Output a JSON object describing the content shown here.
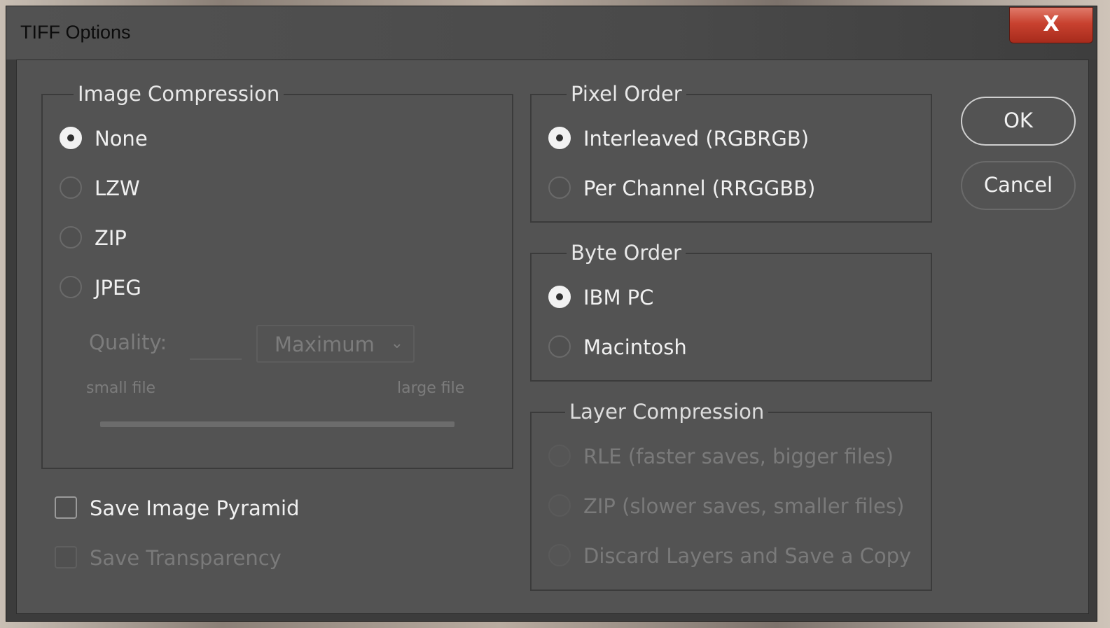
{
  "window": {
    "title": "TIFF Options",
    "close_glyph": "X"
  },
  "image_compression": {
    "legend": "Image Compression",
    "options": [
      {
        "label": "None",
        "selected": true
      },
      {
        "label": "LZW",
        "selected": false
      },
      {
        "label": "ZIP",
        "selected": false
      },
      {
        "label": "JPEG",
        "selected": false
      }
    ],
    "quality_label": "Quality:",
    "quality_value": "",
    "quality_select": "Maximum",
    "small_file_label": "small file",
    "large_file_label": "large file"
  },
  "pixel_order": {
    "legend": "Pixel Order",
    "options": [
      {
        "label": "Interleaved (RGBRGB)",
        "selected": true
      },
      {
        "label": "Per Channel (RRGGBB)",
        "selected": false
      }
    ]
  },
  "byte_order": {
    "legend": "Byte Order",
    "options": [
      {
        "label": "IBM PC",
        "selected": true
      },
      {
        "label": "Macintosh",
        "selected": false
      }
    ]
  },
  "layer_compression": {
    "legend": "Layer Compression",
    "options": [
      {
        "label": "RLE (faster saves, bigger files)",
        "enabled": false
      },
      {
        "label": "ZIP (slower saves, smaller files)",
        "enabled": false
      },
      {
        "label": "Discard Layers and Save a Copy",
        "enabled": false
      }
    ]
  },
  "checkboxes": {
    "save_image_pyramid": {
      "label": "Save Image Pyramid",
      "checked": false,
      "enabled": true
    },
    "save_transparency": {
      "label": "Save Transparency",
      "checked": false,
      "enabled": false
    }
  },
  "buttons": {
    "ok": "OK",
    "cancel": "Cancel"
  },
  "icons": {
    "close": "close-icon",
    "dropdown": "chevron-down-icon"
  }
}
